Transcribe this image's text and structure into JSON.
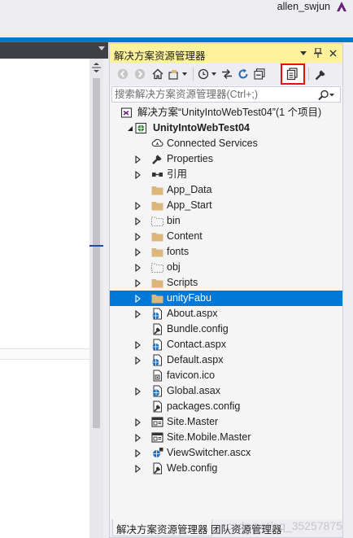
{
  "user": {
    "name": "allen_swjun"
  },
  "panel": {
    "title": "解决方案资源管理器",
    "search_placeholder": "搜索解决方案资源管理器(Ctrl+;)"
  },
  "tree": [
    {
      "label": "解决方案“UnityIntoWebTest04”(1 个项目)",
      "icon": "solution-icon",
      "expander": "none",
      "level": 0,
      "bold": false,
      "selected": false
    },
    {
      "label": "UnityIntoWebTest04",
      "icon": "web-project-icon",
      "expander": "expanded",
      "level": 1,
      "bold": true,
      "selected": false
    },
    {
      "label": "Connected Services",
      "icon": "connected-services-icon",
      "expander": "none",
      "level": 2,
      "bold": false,
      "selected": false
    },
    {
      "label": "Properties",
      "icon": "wrench-icon",
      "expander": "collapsed",
      "level": 2,
      "bold": false,
      "selected": false
    },
    {
      "label": "引用",
      "icon": "references-icon",
      "expander": "collapsed",
      "level": 2,
      "bold": false,
      "selected": false
    },
    {
      "label": "App_Data",
      "icon": "folder-icon",
      "expander": "none",
      "level": 2,
      "bold": false,
      "selected": false
    },
    {
      "label": "App_Start",
      "icon": "folder-icon",
      "expander": "collapsed",
      "level": 2,
      "bold": false,
      "selected": false
    },
    {
      "label": "bin",
      "icon": "hidden-folder-icon",
      "expander": "collapsed",
      "level": 2,
      "bold": false,
      "selected": false
    },
    {
      "label": "Content",
      "icon": "folder-icon",
      "expander": "collapsed",
      "level": 2,
      "bold": false,
      "selected": false
    },
    {
      "label": "fonts",
      "icon": "folder-icon",
      "expander": "collapsed",
      "level": 2,
      "bold": false,
      "selected": false
    },
    {
      "label": "obj",
      "icon": "hidden-folder-icon",
      "expander": "collapsed",
      "level": 2,
      "bold": false,
      "selected": false
    },
    {
      "label": "Scripts",
      "icon": "folder-icon",
      "expander": "collapsed",
      "level": 2,
      "bold": false,
      "selected": false
    },
    {
      "label": "unityFabu",
      "icon": "folder-icon",
      "expander": "collapsed",
      "level": 2,
      "bold": false,
      "selected": true
    },
    {
      "label": "About.aspx",
      "icon": "aspx-page-icon",
      "expander": "collapsed",
      "level": 2,
      "bold": false,
      "selected": false
    },
    {
      "label": "Bundle.config",
      "icon": "config-file-icon",
      "expander": "none",
      "level": 2,
      "bold": false,
      "selected": false
    },
    {
      "label": "Contact.aspx",
      "icon": "aspx-page-icon",
      "expander": "collapsed",
      "level": 2,
      "bold": false,
      "selected": false
    },
    {
      "label": "Default.aspx",
      "icon": "aspx-page-icon",
      "expander": "collapsed",
      "level": 2,
      "bold": false,
      "selected": false
    },
    {
      "label": "favicon.ico",
      "icon": "ico-file-icon",
      "expander": "none",
      "level": 2,
      "bold": false,
      "selected": false
    },
    {
      "label": "Global.asax",
      "icon": "global-asax-icon",
      "expander": "collapsed",
      "level": 2,
      "bold": false,
      "selected": false
    },
    {
      "label": "packages.config",
      "icon": "config-file-icon",
      "expander": "none",
      "level": 2,
      "bold": false,
      "selected": false
    },
    {
      "label": "Site.Master",
      "icon": "master-page-icon",
      "expander": "collapsed",
      "level": 2,
      "bold": false,
      "selected": false
    },
    {
      "label": "Site.Mobile.Master",
      "icon": "master-page-icon",
      "expander": "collapsed",
      "level": 2,
      "bold": false,
      "selected": false
    },
    {
      "label": "ViewSwitcher.ascx",
      "icon": "user-control-icon",
      "expander": "collapsed",
      "level": 2,
      "bold": false,
      "selected": false
    },
    {
      "label": "Web.config",
      "icon": "config-file-icon",
      "expander": "collapsed",
      "level": 2,
      "bold": false,
      "selected": false
    }
  ],
  "bottom_tabs": {
    "solution": "解决方案资源管理器",
    "team": "团队资源管理器",
    "watermark": "csdn.net/qq_35257875"
  },
  "colors": {
    "title_bar": "#fff29d",
    "selection": "#0078d7",
    "highlight_box": "#e51400",
    "folder": "#dcb67a"
  }
}
